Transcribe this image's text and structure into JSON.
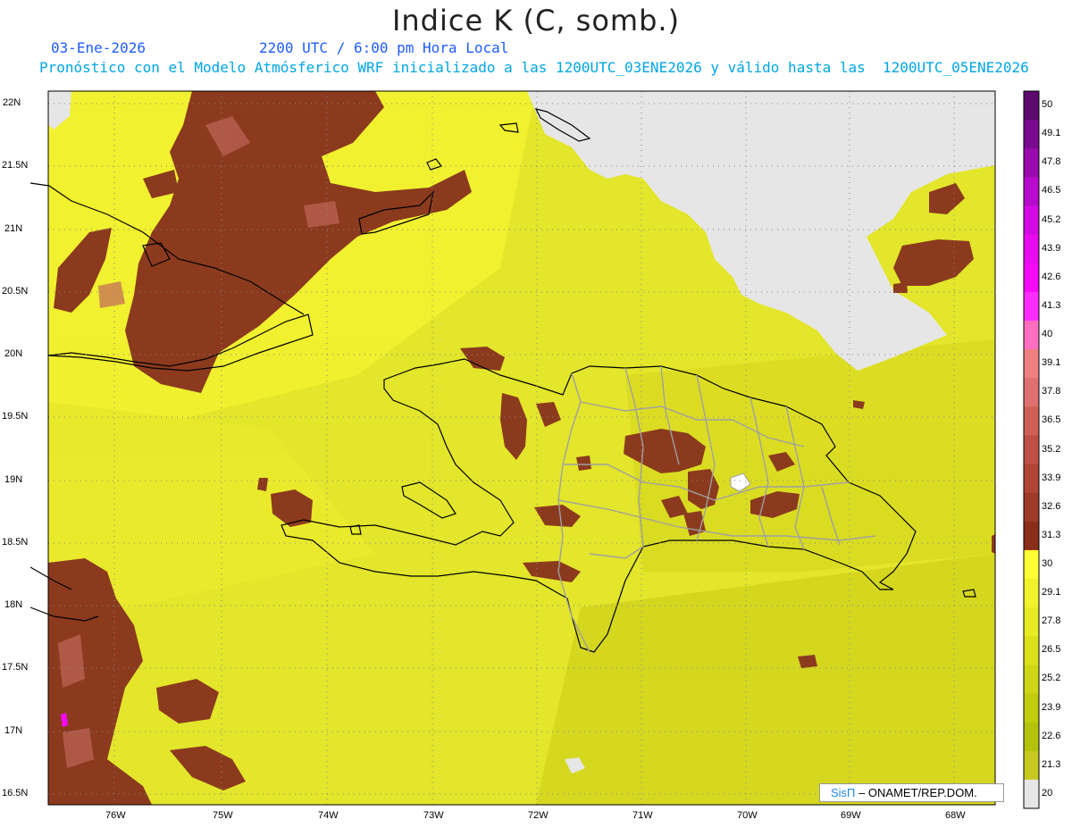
{
  "header": {
    "title": "Indice K (C, somb.)",
    "date": "03-Ene-2026",
    "time": "2200 UTC / 6:00 pm Hora Local",
    "description": "Pronóstico con el Modelo Atmósferico WRF inicializado a las 1200UTC_03ENE2026 y válido hasta las  1200UTC_05ENE2026"
  },
  "axes": {
    "lat_labels": [
      "22N",
      "21.5N",
      "21N",
      "20.5N",
      "20N",
      "19.5N",
      "19N",
      "18.5N",
      "18N",
      "17.5N",
      "17N",
      "16.5N"
    ],
    "lon_labels": [
      "76W",
      "75W",
      "74W",
      "73W",
      "72W",
      "71W",
      "70W",
      "69W",
      "68W"
    ]
  },
  "colorbar": {
    "levels": [
      "50",
      "49.1",
      "47.8",
      "46.5",
      "45.2",
      "43.9",
      "42.6",
      "41.3",
      "40",
      "39.1",
      "37.8",
      "36.5",
      "35.2",
      "33.9",
      "32.6",
      "31.3",
      "30",
      "29.1",
      "27.8",
      "26.5",
      "25.2",
      "23.9",
      "22.6",
      "21.3",
      "20"
    ],
    "colors": [
      "#5c0a6e",
      "#7a0a8f",
      "#9a0aae",
      "#b80acc",
      "#d30ae3",
      "#e80af0",
      "#f40af8",
      "#ff2cff",
      "#ff6ec0",
      "#f08080",
      "#e07070",
      "#d06055",
      "#c05045",
      "#b04535",
      "#9e3a28",
      "#8a2e1a",
      "#ffff33",
      "#f2f22a",
      "#e8eb22",
      "#dbe01a",
      "#cfd615",
      "#c2cc10",
      "#b5c20b",
      "#c8c820",
      "#e6e6e6"
    ]
  },
  "credit": {
    "brand": "SisΠ",
    "text": "– ONAMET/REP.DOM."
  }
}
